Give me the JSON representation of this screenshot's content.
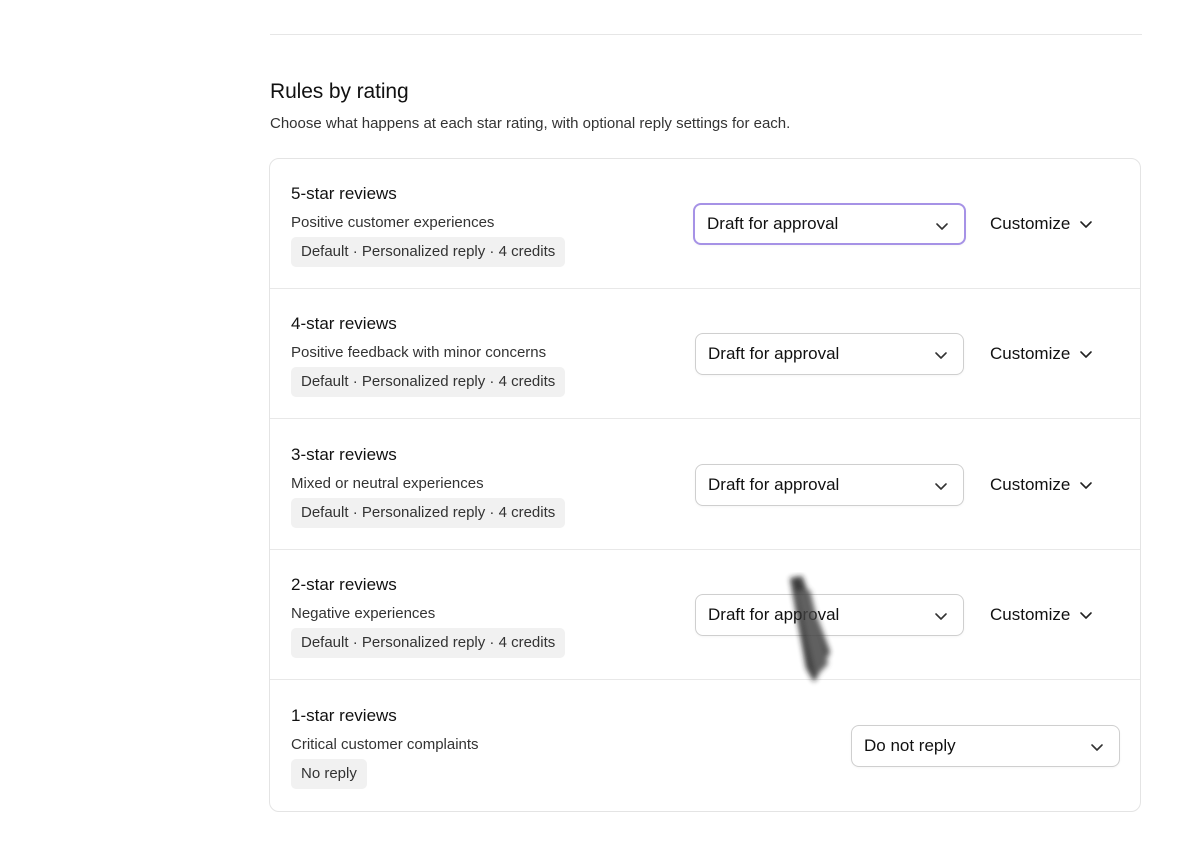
{
  "section": {
    "title": "Rules by rating",
    "description": "Choose what happens at each star rating, with optional reply settings for each."
  },
  "rules": [
    {
      "title": "5-star reviews",
      "subtitle": "Positive customer experiences",
      "badge": "Default · Personalized reply · 4 credits",
      "action": "Draft for approval",
      "customize_label": "Customize",
      "focused": true
    },
    {
      "title": "4-star reviews",
      "subtitle": "Positive feedback with minor concerns",
      "badge": "Default · Personalized reply · 4 credits",
      "action": "Draft for approval",
      "customize_label": "Customize"
    },
    {
      "title": "3-star reviews",
      "subtitle": "Mixed or neutral experiences",
      "badge": "Default · Personalized reply · 4 credits",
      "action": "Draft for approval",
      "customize_label": "Customize"
    },
    {
      "title": "2-star reviews",
      "subtitle": "Negative experiences",
      "badge": "Default · Personalized reply · 4 credits",
      "action": "Draft for approval",
      "customize_label": "Customize"
    },
    {
      "title": "1-star reviews",
      "subtitle": "Critical customer complaints",
      "badge": "No reply",
      "action": "Do not reply"
    }
  ],
  "colors": {
    "focus_ring": "#a692e6",
    "badge_bg": "#f1f1f1",
    "border": "#e4e4e4"
  }
}
